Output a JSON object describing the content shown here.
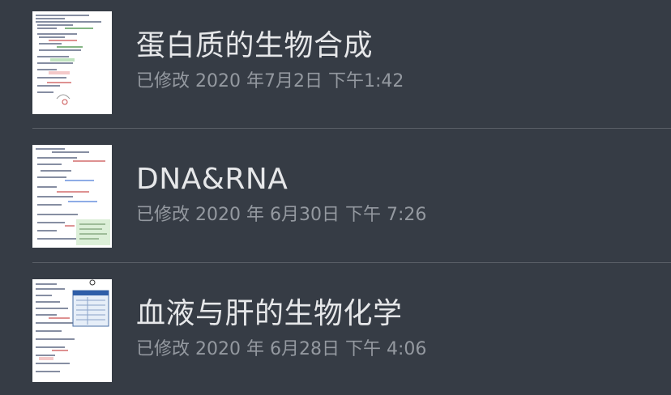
{
  "notes": [
    {
      "title": "蛋白质的生物合成",
      "modified": "已修改 2020 年7月2日 下午1:42"
    },
    {
      "title": "DNA&RNA",
      "modified": "已修改 2020 年 6月30日 下午 7:26"
    },
    {
      "title": "血液与肝的生物化学",
      "modified": "已修改 2020 年 6月28日 下午 4:06"
    }
  ],
  "colors": {
    "background": "#363c45",
    "title": "#e6e7e9",
    "meta": "#9499a0",
    "divider": "#5b6068"
  }
}
